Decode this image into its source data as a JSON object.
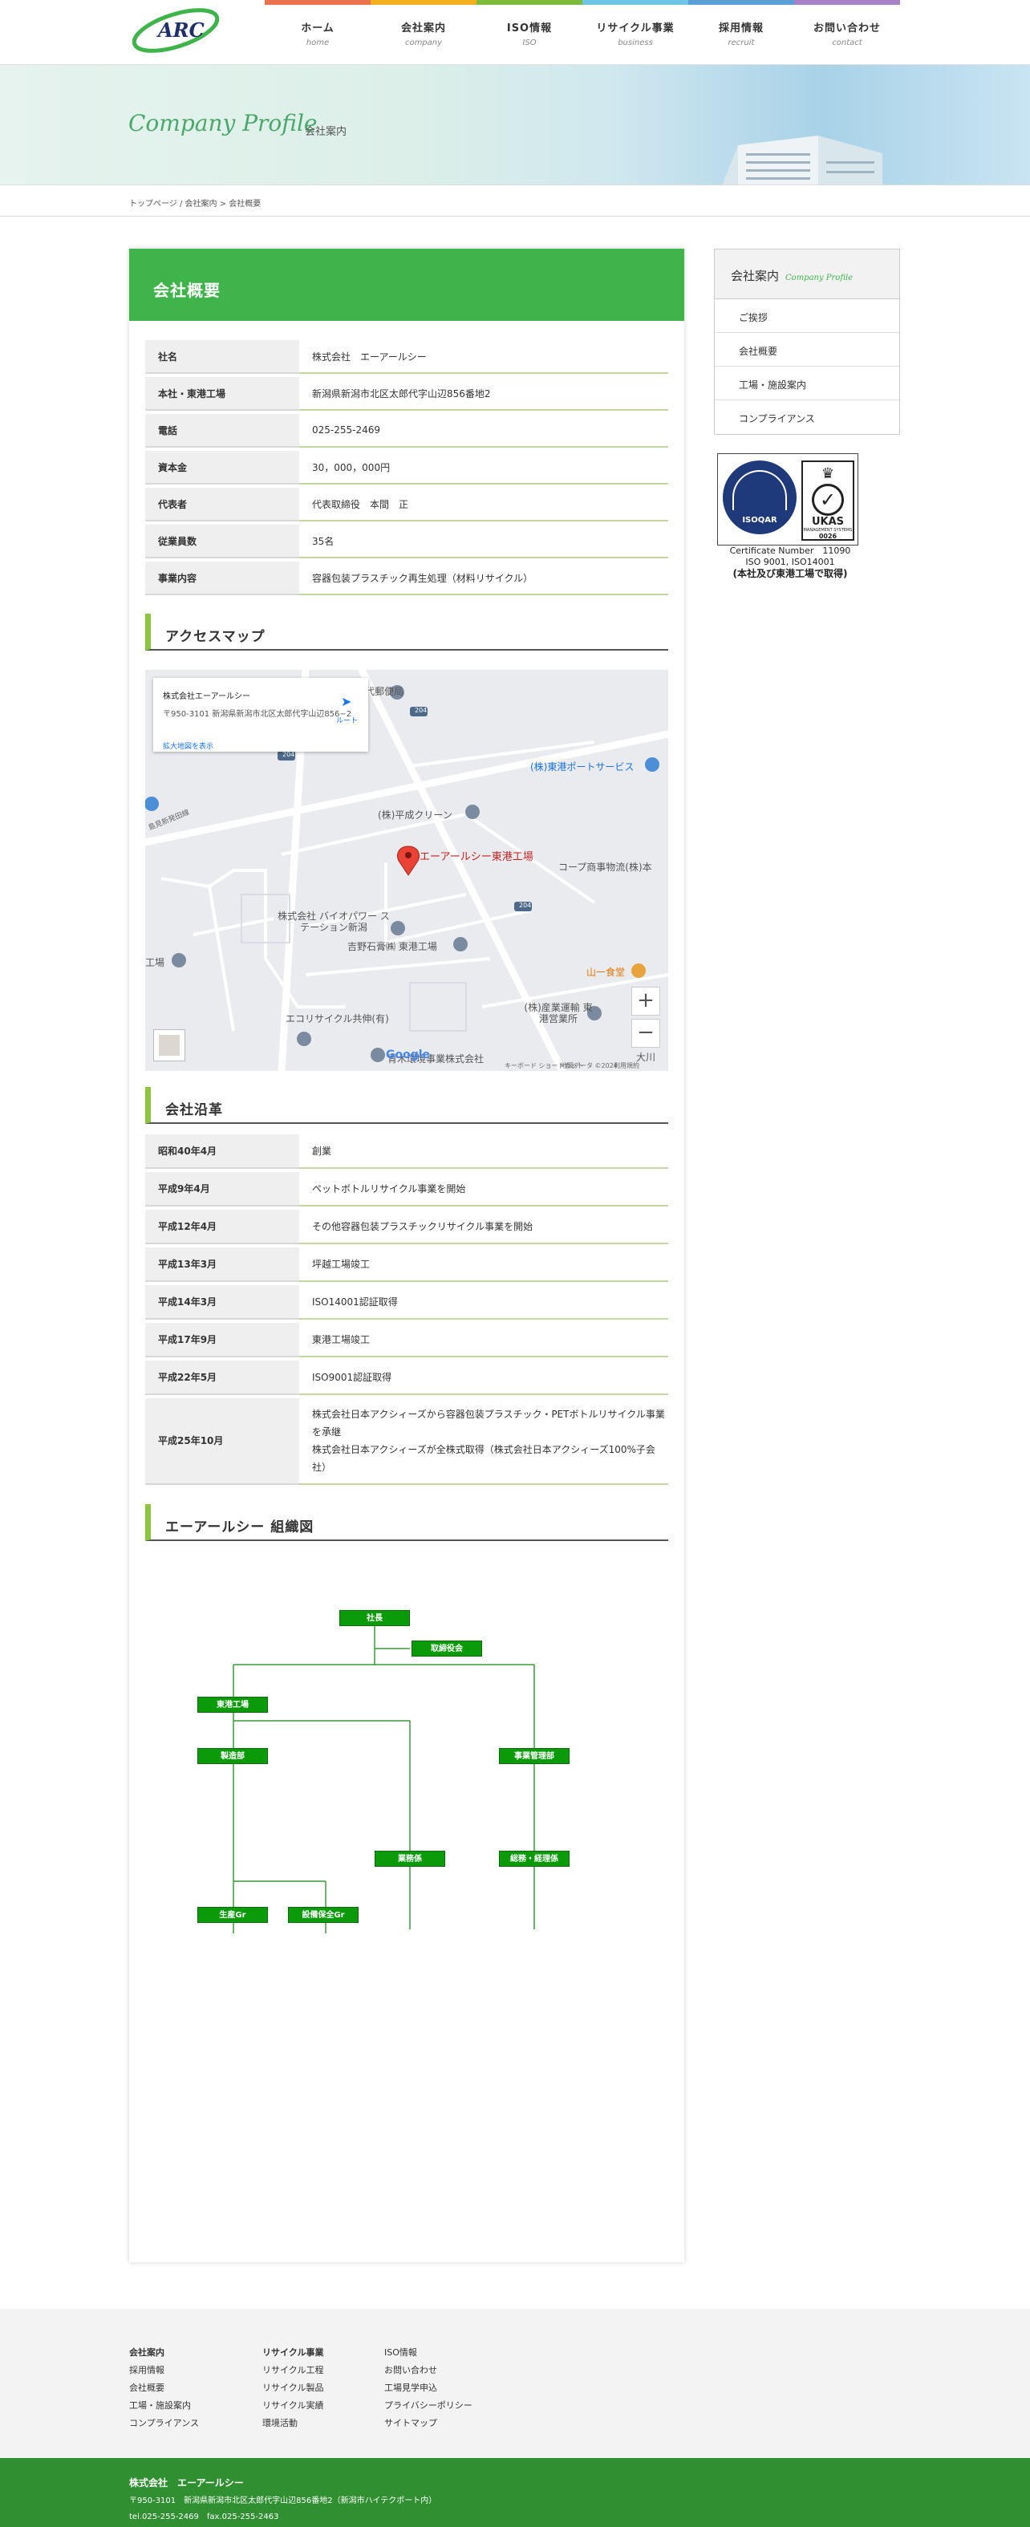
{
  "nav": {
    "items": [
      {
        "jp": "ホーム",
        "en": "home",
        "color": "#e8734b"
      },
      {
        "jp": "会社案内",
        "en": "company",
        "color": "#f2b01e"
      },
      {
        "jp": "ISO情報",
        "en": "ISO",
        "color": "#7cbb3c"
      },
      {
        "jp": "リサイクル事業",
        "en": "business",
        "color": "#6ec6e6"
      },
      {
        "jp": "採用情報",
        "en": "recruit",
        "color": "#5b9ed8"
      },
      {
        "jp": "お問い合わせ",
        "en": "contact",
        "color": "#a983c8"
      }
    ]
  },
  "logo": {
    "text": "ARC"
  },
  "hero": {
    "title": "Company Profile",
    "subtitle": "会社案内"
  },
  "breadcrumb": "トップページ / 会社案内 > 会社概要",
  "main": {
    "title": "会社概要",
    "info": [
      {
        "k": "社名",
        "v": "株式会社　エーアールシー"
      },
      {
        "k": "本社・東港工場",
        "v": "新潟県新潟市北区太郎代字山辺856番地2"
      },
      {
        "k": "電話",
        "v": "025-255-2469"
      },
      {
        "k": "資本金",
        "v": "30，000，000円"
      },
      {
        "k": "代表者",
        "v": "代表取締役　本間　正"
      },
      {
        "k": "従業員数",
        "v": "35名"
      },
      {
        "k": "事業内容",
        "v": "容器包装プラスチック再生処理（材料リサイクル）"
      }
    ],
    "access_title": "アクセスマップ",
    "map": {
      "card_title": "株式会社エーアールシー",
      "card_address": "〒950-3101 新潟県新潟市北区太郎代字山辺856−2",
      "card_link": "拡大地図を表示",
      "card_dir": "ルート",
      "pin_label": "エーアールシー東港工場",
      "labels": {
        "post": "太郎代郵便局",
        "toko": "(株)東港ポートサービス",
        "heisei": "(株)平成クリーン",
        "coop": "コープ商事物流(株)本",
        "bio": "株式会社 バイオパワー ステーション新潟",
        "yoshino": "吉野石膏㈱ 東港工場",
        "road": "島見新発田線",
        "kojo": "工場",
        "yamaichi": "山一食堂",
        "eco": "エコリサイクル共伸(有)",
        "sangyo": "(株)産業運輸 東港営業所",
        "aoki": "青木環境事業株式会社",
        "ohkawa": "大川",
        "r204a": "204",
        "r204b": "204",
        "r204c": "204",
        "copyright": "地図データ ©2024",
        "shortcuts": "キーボード ショートカット",
        "terms": "利用規約",
        "google": "Google"
      }
    },
    "history_title": "会社沿革",
    "history": [
      {
        "k": "昭和40年4月",
        "v": "創業"
      },
      {
        "k": "平成9年4月",
        "v": "ペットボトルリサイクル事業を開始"
      },
      {
        "k": "平成12年4月",
        "v": "その他容器包装プラスチックリサイクル事業を開始"
      },
      {
        "k": "平成13年3月",
        "v": "坪越工場竣工"
      },
      {
        "k": "平成14年3月",
        "v": "ISO14001認証取得"
      },
      {
        "k": "平成17年9月",
        "v": "東港工場竣工"
      },
      {
        "k": "平成22年5月",
        "v": "ISO9001認証取得"
      },
      {
        "k": "平成25年10月",
        "v": "株式会社日本アクシィーズから容器包装プラスチック・PETボトルリサイクル事業を承継",
        "v2": "株式会社日本アクシィーズが全株式取得（株式会社日本アクシィーズ100%子会社）"
      }
    ],
    "org_title": "エーアールシー 組織図",
    "org": {
      "president": "社長",
      "board": "取締役会",
      "factory": "東港工場",
      "mfg": "製造部",
      "admin": "事業管理部",
      "ops": "業務係",
      "gen": "総務・経理係",
      "prod": "生産Gr",
      "maint": "設備保全Gr"
    }
  },
  "sidebar": {
    "title": "会社案内",
    "title_en": "Company Profile",
    "items": [
      "ご挨拶",
      "会社概要",
      "工場・施設案内",
      "コンプライアンス"
    ]
  },
  "iso": {
    "isoqar": "ISOQAR",
    "ukas": "UKAS",
    "ukas_sub": "MANAGEMENT SYSTEMS",
    "ukas_num": "0026",
    "cert": "Certificate Number　11090",
    "std": "ISO 9001, ISO14001",
    "note": "(本社及び東港工場で取得)"
  },
  "footer": {
    "col1": [
      "会社案内",
      "採用情報",
      "会社概要",
      "工場・施設案内",
      "コンプライアンス"
    ],
    "col2": [
      "リサイクル事業",
      "リサイクル工程",
      "リサイクル製品",
      "リサイクル実績",
      "環境活動"
    ],
    "col3": [
      "ISO情報",
      "お問い合わせ",
      "工場見学申込",
      "プライバシーポリシー",
      "サイトマップ"
    ],
    "company": "株式会社　エーアールシー",
    "address": "〒950-3101　新潟県新潟市北区太郎代字山辺856番地2（新潟市ハイテクポート内）",
    "tel": "tel.025-255-2469　fax.025-255-2463"
  }
}
